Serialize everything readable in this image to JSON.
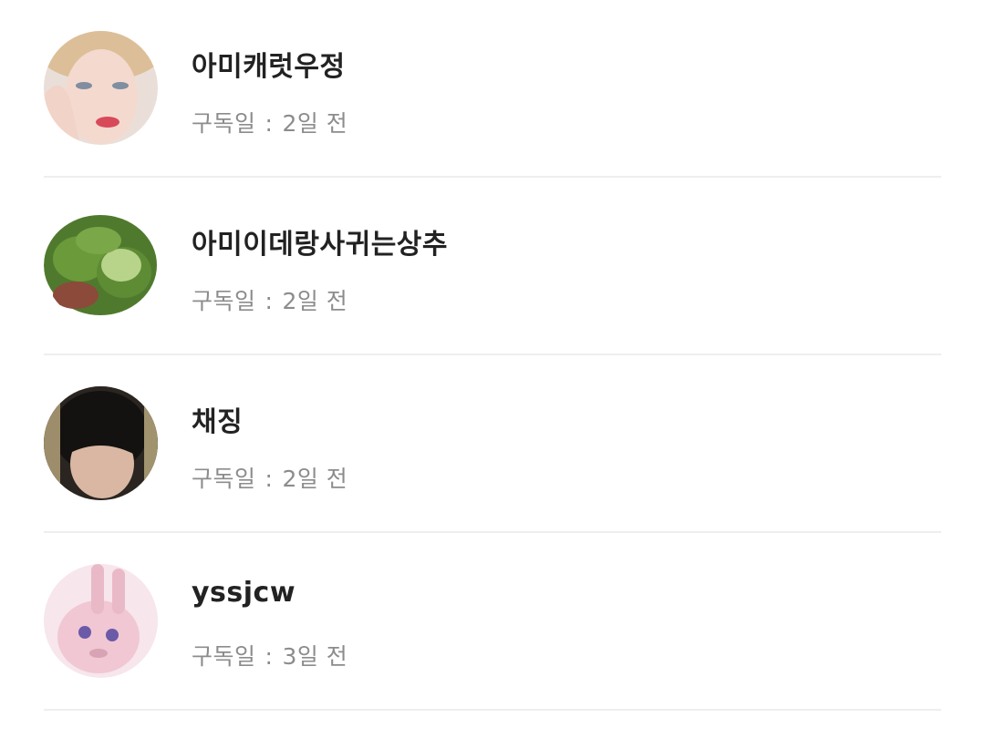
{
  "subscribers": [
    {
      "name": "아미캐럿우정",
      "label": "구독일",
      "separator": ":",
      "when": "2일 전",
      "avatar": "person-photo-blonde"
    },
    {
      "name": "아미이데랑사귀는상추",
      "label": "구독일",
      "separator": ":",
      "when": "2일 전",
      "avatar": "lettuce-photo"
    },
    {
      "name": "채징",
      "label": "구독일",
      "separator": ":",
      "when": "2일 전",
      "avatar": "person-photo-dark-hair"
    },
    {
      "name": "yssjcw",
      "label": "구독일",
      "separator": ":",
      "when": "3일 전",
      "avatar": "pink-bunny-toy-photo"
    }
  ]
}
